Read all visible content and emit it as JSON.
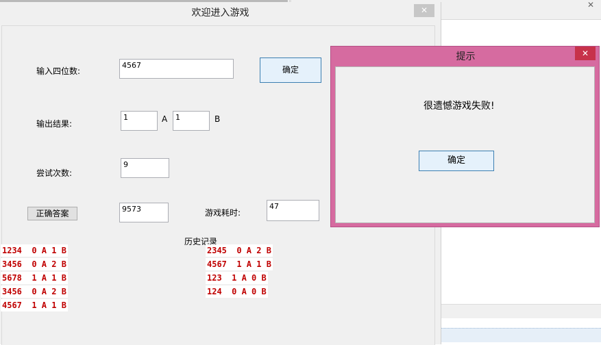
{
  "main_window": {
    "title": "欢迎进入游戏",
    "close_glyph": "✕"
  },
  "form": {
    "input_label": "输入四位数:",
    "input_value": "4567",
    "confirm_button": "确定",
    "result_label": "输出结果:",
    "result_a_value": "1",
    "result_a_unit": "A",
    "result_b_value": "1",
    "result_b_unit": "B",
    "attempts_label": "尝试次数:",
    "attempts_value": "9",
    "answer_button": "正确答案",
    "answer_value": "9573",
    "time_label": "游戏耗时:",
    "time_value": "47"
  },
  "history": {
    "title": "历史记录",
    "left": [
      "1234  0 A 1 B",
      "3456  0 A 2 B",
      "5678  1 A 1 B",
      "3456  0 A 2 B",
      "4567  1 A 1 B"
    ],
    "right": [
      "2345  0 A 2 B",
      "4567  1 A 1 B",
      "123  1 A 0 B",
      "124  0 A 0 B"
    ]
  },
  "dialog": {
    "title": "提示",
    "close_glyph": "✕",
    "message": "很遗憾游戏失败!",
    "ok_button": "确定"
  },
  "background": {
    "close_glyph": "✕"
  }
}
